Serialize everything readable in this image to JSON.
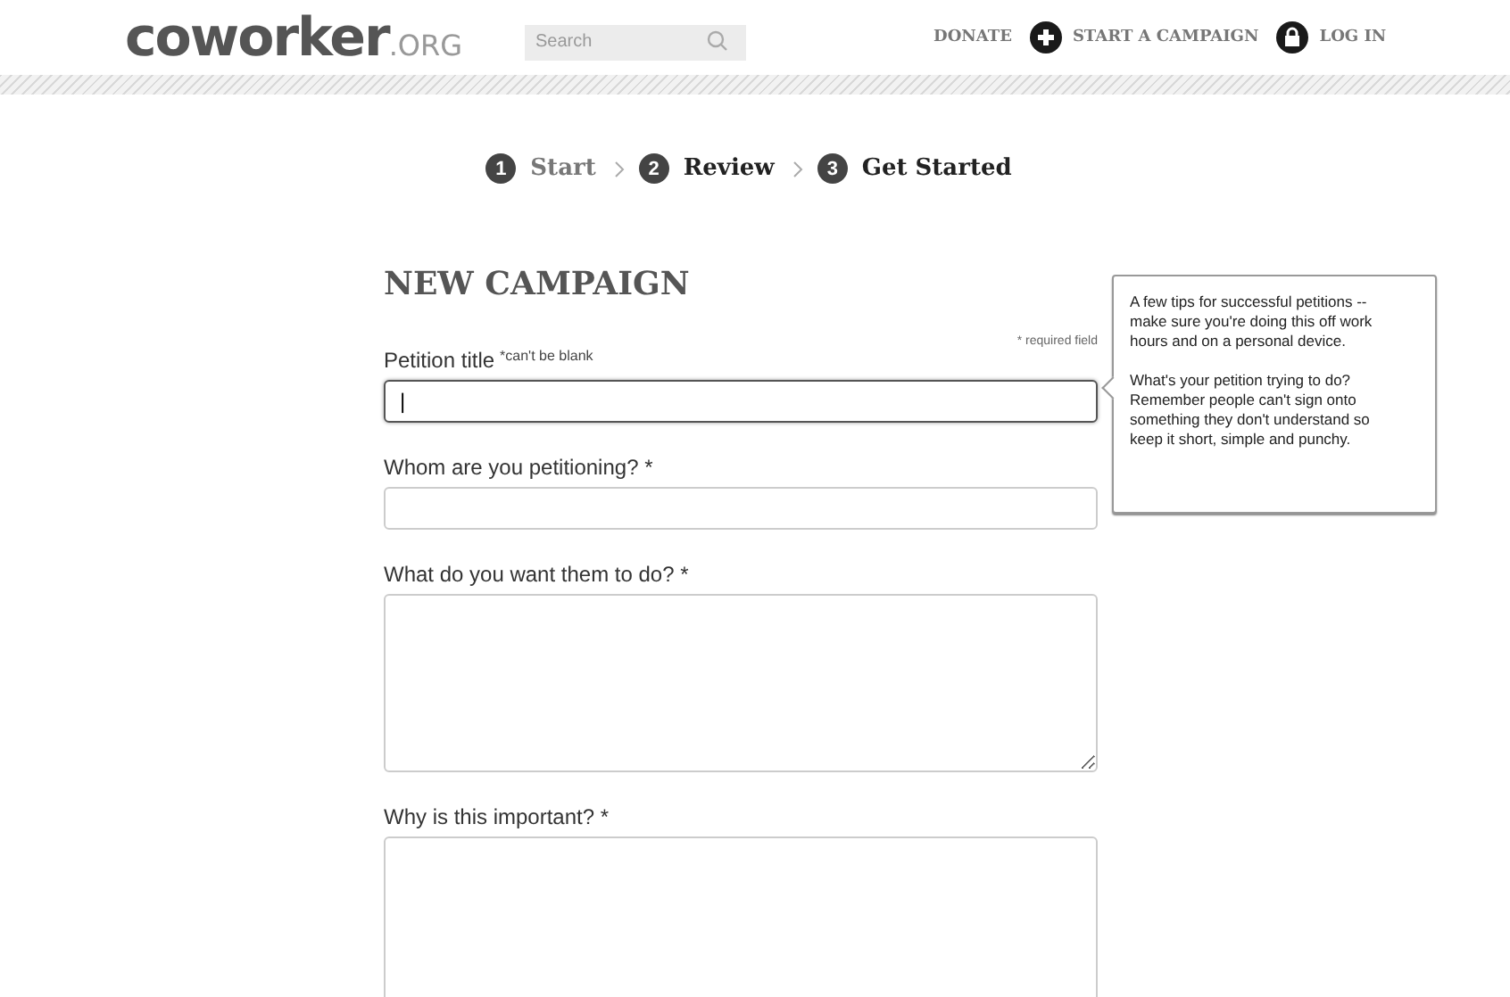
{
  "header": {
    "logo": {
      "main": "coworker",
      "suffix": ".ORG"
    },
    "search": {
      "placeholder": "Search"
    },
    "nav": [
      {
        "label": "DONATE",
        "kind": "plain"
      },
      {
        "label": "START A CAMPAIGN",
        "kind": "add"
      },
      {
        "label": "LOG IN",
        "kind": "account"
      }
    ]
  },
  "steps": [
    {
      "number": "1",
      "label": "Start",
      "done": true
    },
    {
      "number": "2",
      "label": "Review",
      "done": false
    },
    {
      "number": "3",
      "label": "Get Started",
      "done": false
    }
  ],
  "form": {
    "title": "NEW CAMPAIGN",
    "required_note": "* required field",
    "fields": [
      {
        "kind": "input",
        "label": "Petition title",
        "error": "*can't be blank",
        "focused": true,
        "value": "|"
      },
      {
        "kind": "input",
        "label": "Whom are you petitioning? *",
        "focused": false
      },
      {
        "kind": "textarea",
        "label": "What do you want them to do? *",
        "focused": false
      },
      {
        "kind": "textarea",
        "label": "Why is this important? *",
        "focused": false
      }
    ]
  },
  "tooltip": {
    "paragraphs": [
      "A few tips for successful petitions -- make sure you're doing this off work hours and on a personal device.",
      "What's your petition trying to do? Remember people can't sign onto something they don't understand so keep it short, simple and punchy."
    ]
  }
}
